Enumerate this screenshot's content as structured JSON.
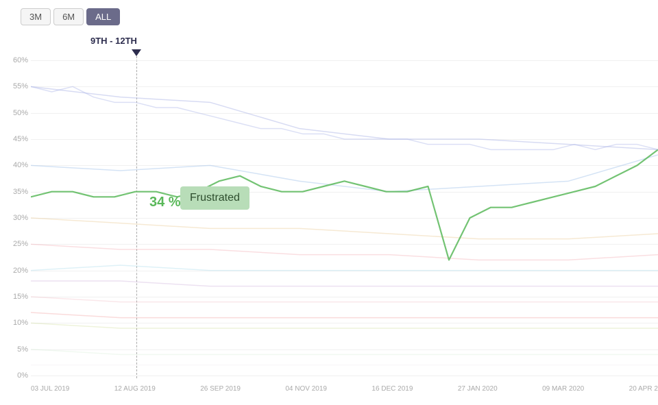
{
  "controls": {
    "buttons": [
      "3M",
      "6M",
      "ALL"
    ],
    "active": "ALL"
  },
  "tooltip": {
    "date_range": "9TH - 12TH",
    "value": "34 %",
    "label": "Frustrated"
  },
  "y_axis": {
    "labels": [
      "60%",
      "55%",
      "50%",
      "45%",
      "40%",
      "35%",
      "30%",
      "25%",
      "20%",
      "15%",
      "10%",
      "5%",
      "0%"
    ]
  },
  "x_axis": {
    "labels": [
      "03 JUL 2019",
      "12 AUG 2019",
      "26 SEP 2019",
      "04 NOV 2019",
      "16 DEC 2019",
      "27 JAN 2020",
      "09 MAR 2020",
      "20 APR 2"
    ]
  },
  "colors": {
    "active_btn_bg": "#6b6b8a",
    "tooltip_bg": "#b8ddb8",
    "dashed_line": "#aaa",
    "green_line": "#5ab85a",
    "value_label": "#5ab85a"
  }
}
